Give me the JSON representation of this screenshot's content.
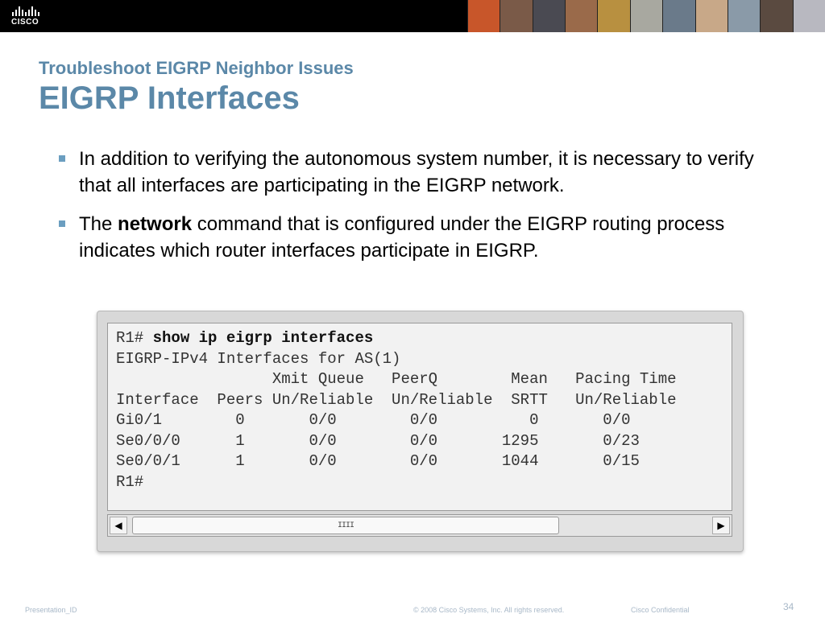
{
  "brand": {
    "logo_text": "CISCO",
    "accent": "#5b88a8",
    "bullet_color": "#6b9ec0"
  },
  "slide": {
    "subtitle": "Troubleshoot EIGRP Neighbor Issues",
    "title": "EIGRP Interfaces",
    "bullets": [
      {
        "text": "In addition to verifying the autonomous system number, it is necessary to verify that all interfaces are participating in the EIGRP network."
      },
      {
        "pre": "The ",
        "bold": "network",
        "post": " command that is configured under the EIGRP routing process indicates which router interfaces participate in EIGRP."
      }
    ]
  },
  "terminal": {
    "prompt": "R1# ",
    "command": "show ip eigrp interfaces",
    "lines": [
      "EIGRP-IPv4 Interfaces for AS(1)",
      "                 Xmit Queue   PeerQ        Mean   Pacing Time",
      "Interface  Peers Un/Reliable  Un/Reliable  SRTT   Un/Reliable",
      "Gi0/1        0       0/0        0/0          0       0/0",
      "Se0/0/0      1       0/0        0/0       1295       0/23",
      "Se0/0/1      1       0/0        0/0       1044       0/15",
      "R1#"
    ],
    "highlight_color": "#f7cfa8",
    "scroll_thumb_label": "IIII"
  },
  "footer": {
    "presentation_id": "Presentation_ID",
    "copyright": "© 2008 Cisco Systems, Inc. All rights reserved.",
    "confidential": "Cisco Confidential",
    "page_number": "34"
  }
}
